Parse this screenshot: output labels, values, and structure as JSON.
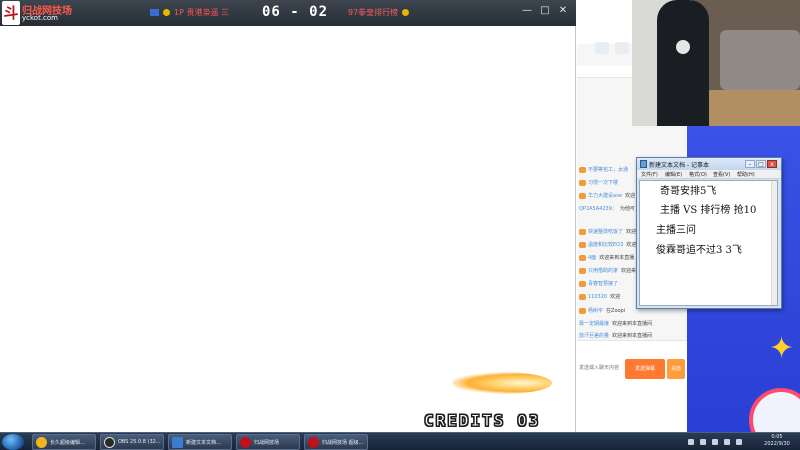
{
  "game": {
    "logo_mark": "斗",
    "logo_name": "归战网技场",
    "logo_url": "yckot.com",
    "score": "06 - 02",
    "player1": "1P  贵港枭遥 三",
    "player2": "97拳皇排行榜",
    "credits": "CREDITS 03",
    "window_controls": [
      "—",
      "□",
      "✕"
    ]
  },
  "live_room": {
    "chat_messages": [
      {
        "user": "不要等包工，太通",
        "msg": ""
      },
      {
        "user": "习惯一次下楼",
        "msg": ""
      },
      {
        "user": "华力大建设ave",
        "msg": "欢迎"
      },
      {
        "user": "QP2A5A4239：",
        "msg": "为他可"
      },
      {
        "user": "快速整改吃饭了",
        "msg": "欢迎"
      },
      {
        "user": "温度和比较EO3",
        "msg": "欢迎"
      },
      {
        "user": "4面",
        "msg": "欢迎来到本直播"
      },
      {
        "user": "只用借助的家",
        "msg": "欢迎来"
      },
      {
        "user": "青春智慧接了",
        "msg": ""
      },
      {
        "user": "110320",
        "msg": "欢迎"
      },
      {
        "user": "杨树平",
        "msg": "在Zoopi"
      },
      {
        "user": "靠一定期最接",
        "msg": "欢迎来到本直播间"
      },
      {
        "user": "放汗巨差的量",
        "msg": "欢迎来到本直播间"
      }
    ],
    "input_placeholder": "发送或入聊天内容",
    "send_label": "发送弹幕",
    "send2_label": "充值"
  },
  "notepad": {
    "title": "新建文本文档 - 记事本",
    "menu": [
      "文件(F)",
      "编辑(E)",
      "格式(O)",
      "查看(V)",
      "帮助(H)"
    ],
    "lines": [
      "奇哥安排5飞",
      "主播  VS  排行榜  抢10",
      "主播三问",
      "俊霖哥追不过3  3飞"
    ]
  },
  "taskbar": {
    "tasks": [
      {
        "label": "长久超级编辑...",
        "color": "#f2b51c"
      },
      {
        "label": "OBS 25.0.8 (32...",
        "color": "#2a2a2a"
      },
      {
        "label": "新建文本文档...",
        "color": "#3d7bd1"
      },
      {
        "label": "归战网技场",
        "color": "#c0101a"
      },
      {
        "label": "归战网技场 超级...",
        "color": "#c0101a"
      }
    ],
    "clock_time": "0:05",
    "clock_date": "2022/9/30"
  }
}
